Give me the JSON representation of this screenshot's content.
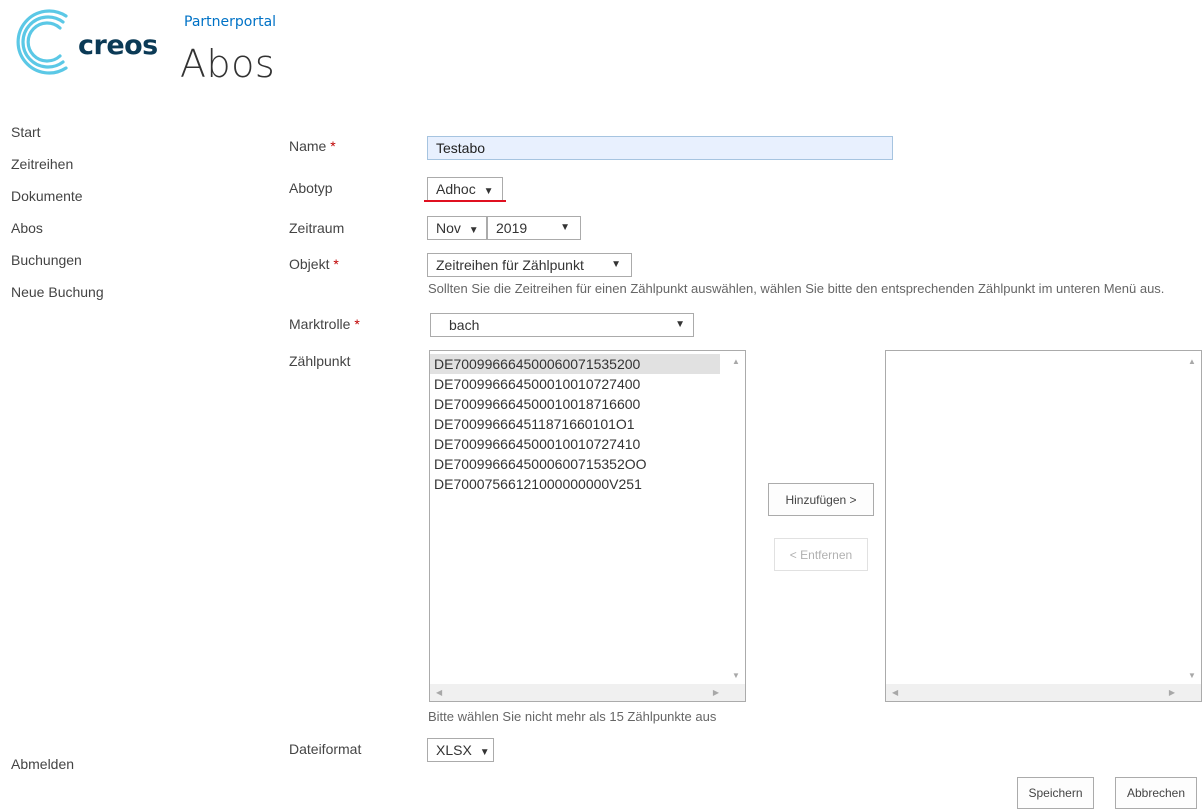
{
  "header": {
    "logo_text": "creos",
    "site_name": "Partnerportal",
    "page_title": "Abos"
  },
  "nav": {
    "items": [
      "Start",
      "Zeitreihen",
      "Dokumente",
      "Abos",
      "Buchungen",
      "Neue Buchung"
    ],
    "logout": "Abmelden"
  },
  "form": {
    "name_label": "Name",
    "name_value": "Testabo",
    "abotyp_label": "Abotyp",
    "abotyp_value": "Adhoc",
    "zeitraum_label": "Zeitraum",
    "zeitraum_month": "Nov",
    "zeitraum_year": "2019",
    "objekt_label": "Objekt",
    "objekt_value": "Zeitreihen für Zählpunkt",
    "objekt_help": "Sollten Sie die Zeitreihen für einen Zählpunkt auswählen, wählen Sie bitte den entsprechenden Zählpunkt im unteren Menü aus.",
    "marktrolle_label": "Marktrolle",
    "marktrolle_value": "bach",
    "zaehlpunkt_label": "Zählpunkt",
    "zaehlpunkt_options": [
      "DE7009966645000600715352OO",
      "DE700996664500010010727400",
      "DE700996664500010018716600",
      "DE700996664511871660101O1",
      "DE700996664500010010727410",
      "DE700996664500060071535200",
      "DE70007566121000000000V251"
    ],
    "zaehlpunkt_help": "Bitte wählen Sie nicht mehr als 15 Zählpunkte aus",
    "add_button": "Hinzufügen >",
    "remove_button": "< Entfernen",
    "dateiformat_label": "Dateiformat",
    "dateiformat_value": "XLSX",
    "required_marker": "*"
  },
  "actions": {
    "save": "Speichern",
    "cancel": "Abbrechen"
  },
  "colors": {
    "accent_blue": "#0072c6",
    "logo_dark": "#0b3a56",
    "logo_light": "#5bc8e6",
    "underline_red": "#e01020"
  }
}
